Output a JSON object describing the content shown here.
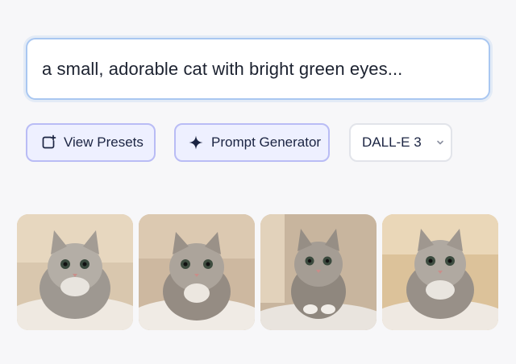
{
  "prompt": {
    "text": "a small, adorable cat with bright green eyes..."
  },
  "toolbar": {
    "presets_label": "View Presets",
    "generator_label": "Prompt Generator",
    "model_selected": "DALL-E 3"
  },
  "gallery": {
    "images": [
      {
        "subject": "fluffy grey tabby kitten on blanket",
        "bg": "#d9c7ae"
      },
      {
        "subject": "fluffy grey tabby kitten on blanket",
        "bg": "#cdb8a0"
      },
      {
        "subject": "fluffy grey tabby kitten on blanket",
        "bg": "#c8b59e"
      },
      {
        "subject": "fluffy grey tabby kitten on blanket",
        "bg": "#dcc29a"
      }
    ]
  },
  "colors": {
    "accent_border": "#a9c7f1",
    "button_fill": "#eef0ff",
    "button_border": "#b9bcf5",
    "text_dark": "#1b2442"
  }
}
